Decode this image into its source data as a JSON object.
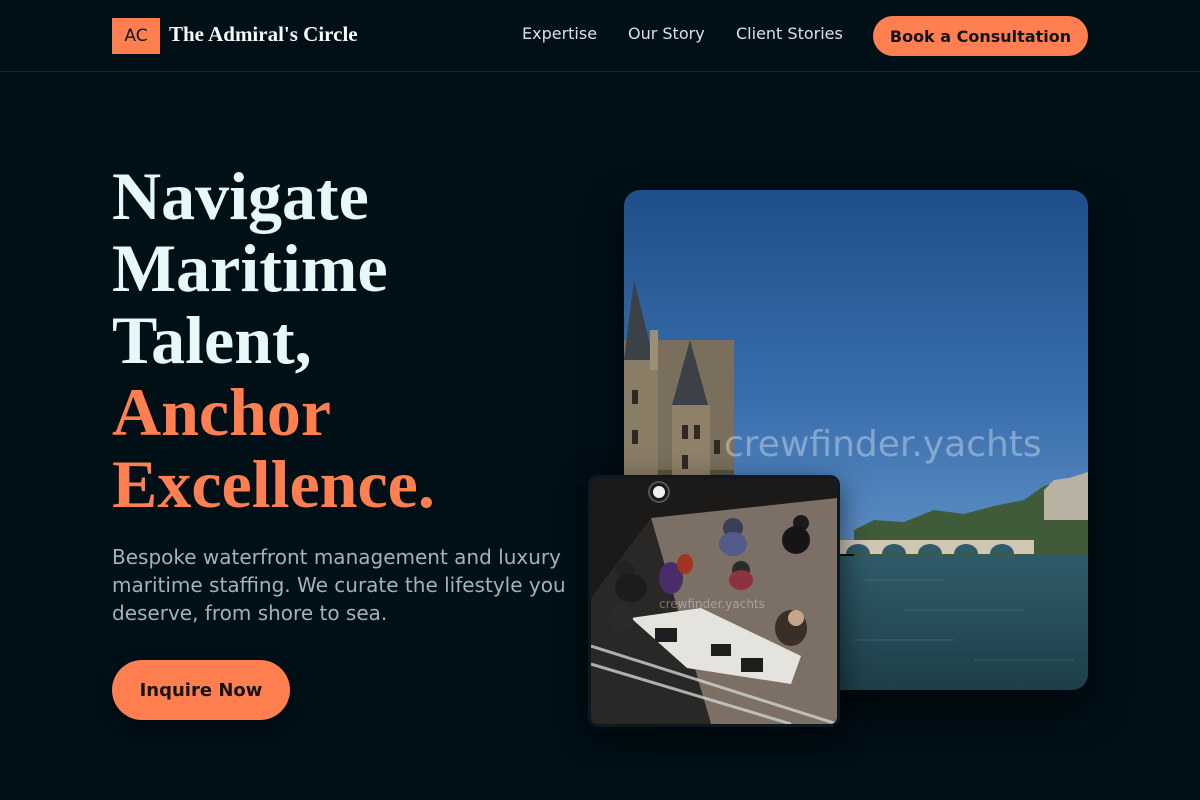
{
  "brand": {
    "mark": "AC",
    "name": "The Admiral's Circle"
  },
  "nav": {
    "items": [
      "Expertise",
      "Our Story",
      "Client Stories"
    ],
    "cta_label": "Book a Consultation"
  },
  "hero": {
    "headline_lines": [
      "Navigate",
      "Maritime",
      "Talent,"
    ],
    "headline_accent_lines": [
      "Anchor",
      "Excellence."
    ],
    "description": "Bespoke waterfront management and luxury maritime staffing. We curate the lifestyle you deserve, from shore to sea.",
    "button_label": "Inquire Now"
  },
  "images": {
    "main": {
      "subject": "river-seine-with-castle-and-bridge",
      "watermark": "crewfinder.yachts"
    },
    "secondary": {
      "subject": "overhead-view-of-people-at-desk",
      "watermark": "crewfinder.yachts"
    }
  },
  "colors": {
    "background": "#010f17",
    "accent": "#ff7f50",
    "text": "#e6f8f8",
    "muted": "#9fb4bc"
  }
}
